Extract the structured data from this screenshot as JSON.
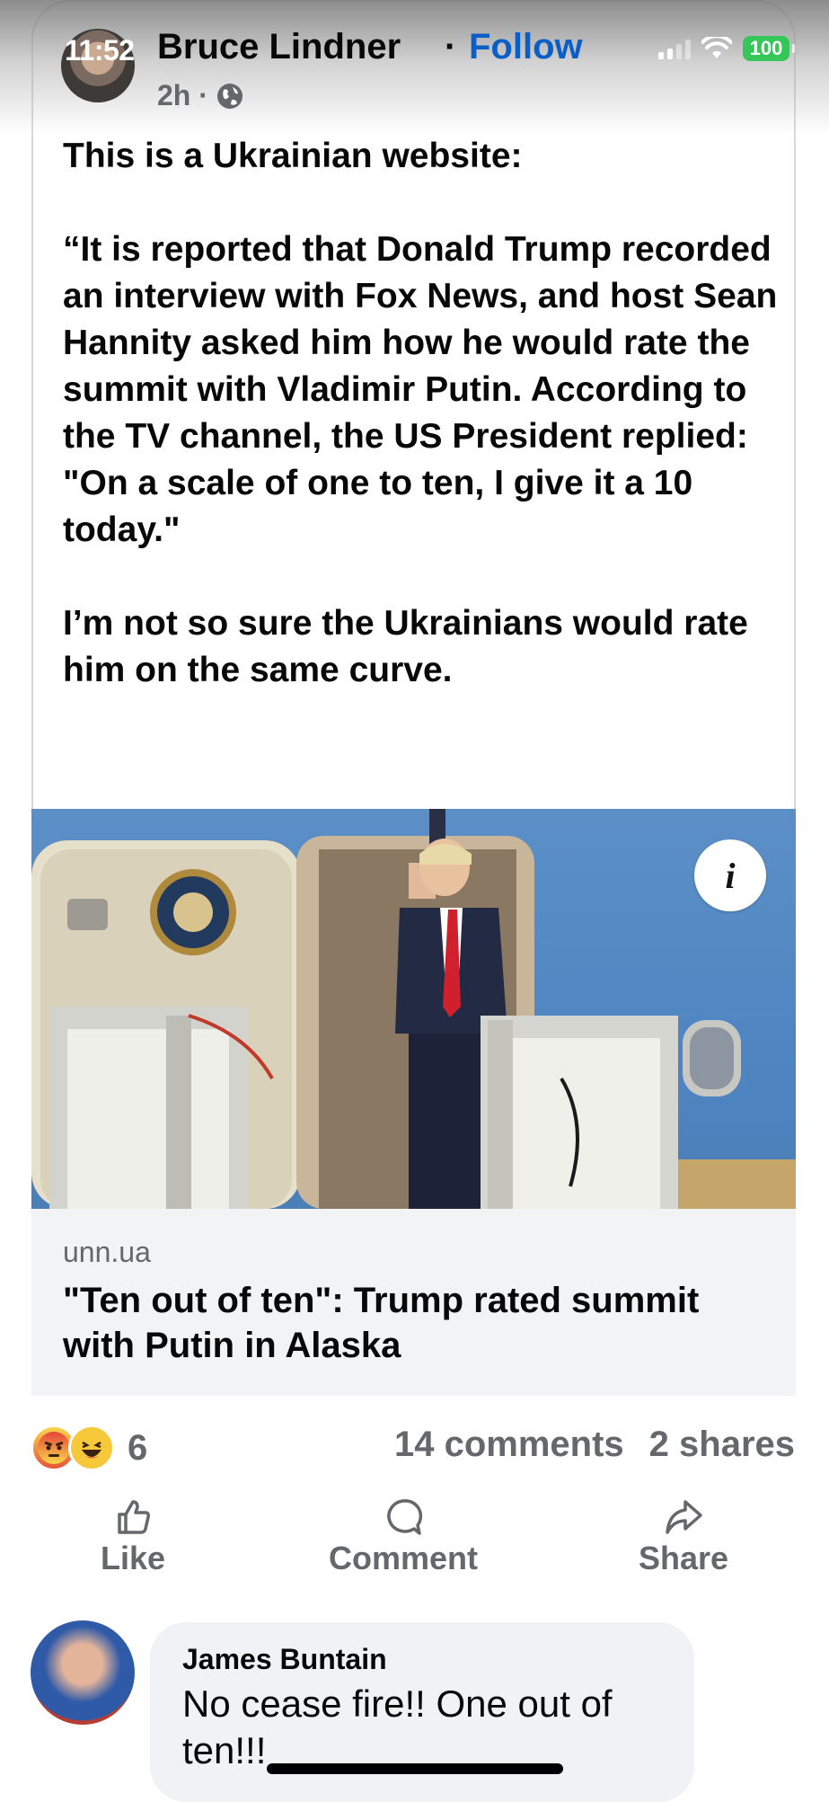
{
  "status_bar": {
    "time": "11:52",
    "battery": "100"
  },
  "post": {
    "author": "Bruce Lindner",
    "separator": "·",
    "follow_label": "Follow",
    "time_ago": "2h ·",
    "paragraphs": [
      "This is a Ukrainian website:",
      "“It is reported that Donald Trump recorded an interview with Fox News, and host Sean Hannity asked him how he would rate the summit with Vladimir Putin. According to the TV channel, the US President replied: \"On a scale of one to ten, I give it a 10 today.\"",
      "I’m not so sure the Ukrainians would rate him on the same curve."
    ]
  },
  "link": {
    "domain": "unn.ua",
    "title": "\"Ten out of ten\": Trump rated summit with Putin in Alaska",
    "info_icon": "i"
  },
  "engagement": {
    "reaction_count": "6",
    "comments": "14 comments",
    "shares": "2 shares"
  },
  "actions": {
    "like": "Like",
    "comment": "Comment",
    "share": "Share"
  },
  "comment": {
    "author": "James Buntain",
    "text": "No cease fire!! One out of ten!!!"
  },
  "colors": {
    "accent": "#0a5ec7",
    "battery": "#36c759",
    "muted": "#65676b"
  }
}
